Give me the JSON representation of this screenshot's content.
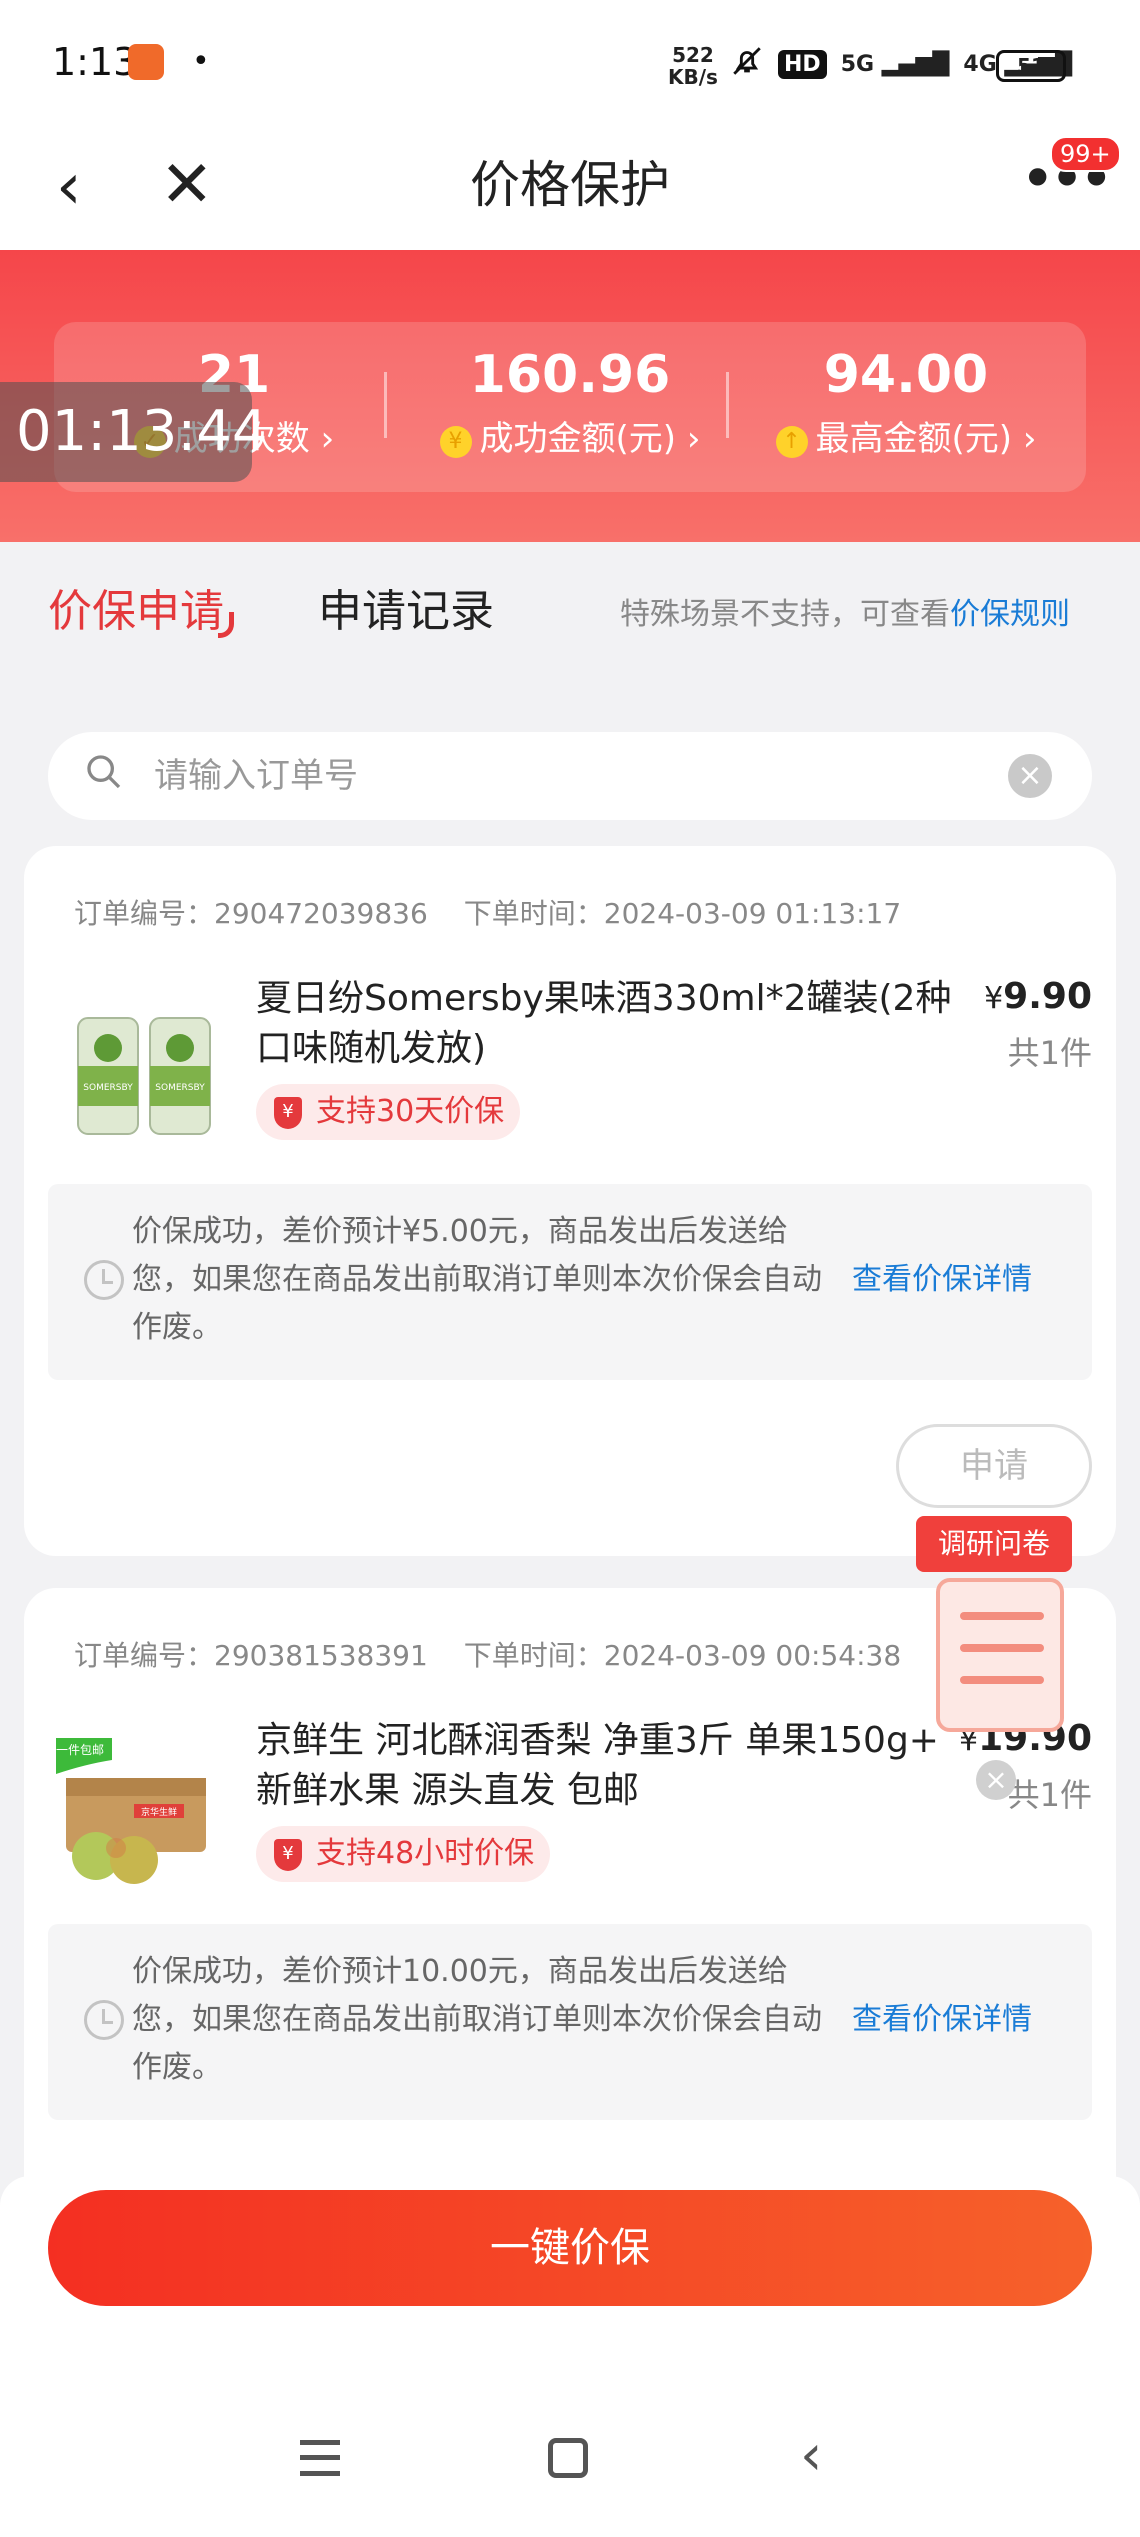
{
  "status_bar": {
    "time": "1:13",
    "bullet": "•",
    "net_speed_value": "522",
    "net_speed_unit": "KB/s",
    "hd": "HD",
    "sig1": "5G",
    "sig2": "4G",
    "battery": "51"
  },
  "navbar": {
    "back": "‹",
    "close": "✕",
    "title": "价格保护",
    "more": "•••",
    "badge": "99+"
  },
  "banner": {
    "stats": [
      {
        "value": "21",
        "label": "成功次数 ›",
        "coin": "✓"
      },
      {
        "value": "160.96",
        "label": "成功金额(元) ›",
        "coin": "¥"
      },
      {
        "value": "94.00",
        "label": "最高金额(元) ›",
        "coin": "↑"
      }
    ],
    "timer": "01:13:44"
  },
  "tabs": {
    "active": "价保申请",
    "inactive": "申请记录",
    "notice": "特殊场景不支持，可查看",
    "rule_link": "价保规则"
  },
  "search": {
    "placeholder": "请输入订单号",
    "clear": "×"
  },
  "orders": [
    {
      "order_no": "订单编号：290472039836",
      "order_time": "下单时间：2024-03-09 01:13:17",
      "product": "夏日纷Somersby果味酒330ml*2罐装(2种口味随机发放)",
      "price_symbol": "¥",
      "price": "9.90",
      "qty": "共1件",
      "guarantee": "支持30天价保",
      "note": "价保成功，差价预计¥5.00元，商品发出后发送给您，如果您在商品发出前取消订单则本次价保会自动作废。",
      "note_link": "查看价保详情",
      "apply": "申请"
    },
    {
      "order_no": "订单编号：290381538391",
      "order_time": "下单时间：2024-03-09 00:54:38",
      "product": "京鲜生 河北酥润香梨 净重3斤 单果150g+ 新鲜水果 源头直发 包邮",
      "price_symbol": "¥",
      "price": "19.90",
      "qty": "共1件",
      "guarantee": "支持48小时价保",
      "note": "价保成功，差价预计10.00元，商品发出后发送给您，如果您在商品发出前取消订单则本次价保会自动作废。",
      "note_link": "查看价保详情",
      "thumb_badge": "一件包邮",
      "box_label": "京华生鲜"
    }
  ],
  "survey": {
    "label": "调研问卷",
    "close": "×"
  },
  "bottom": {
    "cta": "一键价保"
  },
  "product_labels": {
    "can_brand": "SOMERSBY"
  },
  "colors": {
    "accent": "#e4393c",
    "link": "#1a7cd6",
    "banner": "#f5464a"
  }
}
